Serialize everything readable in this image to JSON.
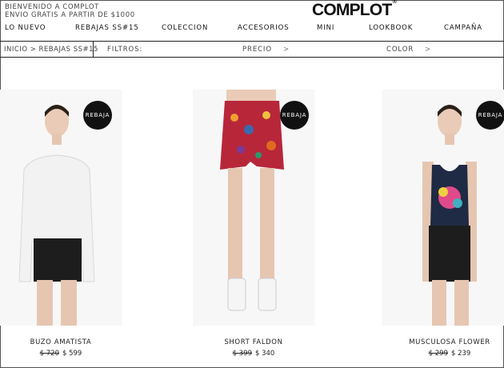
{
  "header": {
    "welcome_line1": "BIENVENIDO A COMPLOT",
    "welcome_line2": "ENVIO GRATIS A PARTIR DE $1000",
    "logo": "COMPLOT",
    "logo_mark": "®"
  },
  "nav": {
    "items": [
      {
        "label": "LO NUEVO"
      },
      {
        "label": "REBAJAS SS#15"
      },
      {
        "label": "COLECCION"
      },
      {
        "label": "ACCESORIOS"
      },
      {
        "label": "MINI"
      },
      {
        "label": "LOOKBOOK"
      },
      {
        "label": "CAMPAÑA"
      }
    ]
  },
  "filterbar": {
    "breadcrumb": "INICIO > REBAJAS SS#15",
    "filters_label": "FILTROS:",
    "price_label": "PRECIO",
    "color_label": "COLOR",
    "arrow": ">"
  },
  "products": [
    {
      "name": "BUZO AMATISTA",
      "old_price": "$ 720",
      "price": "$ 599",
      "badge": "REBAJA"
    },
    {
      "name": "SHORT FALDON",
      "old_price": "$ 399",
      "price": "$ 340",
      "badge": "REBAJA"
    },
    {
      "name": "MUSCULOSA FLOWER",
      "old_price": "$ 299",
      "price": "$ 239",
      "badge": "REBAJA"
    }
  ],
  "colors": {
    "badge_bg": "#111111",
    "text": "#222222",
    "border": "#222222"
  }
}
